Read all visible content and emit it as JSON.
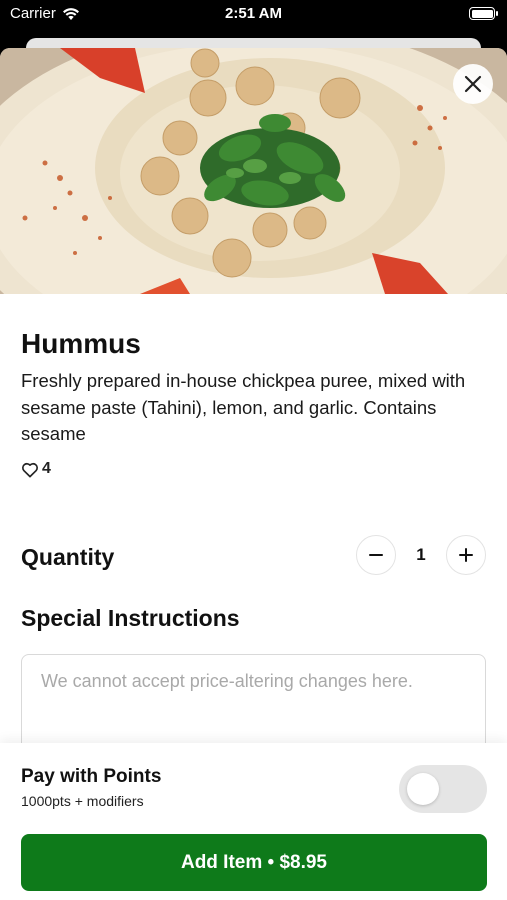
{
  "status_bar": {
    "carrier": "Carrier",
    "time": "2:51 AM"
  },
  "item": {
    "name": "Hummus",
    "description": "Freshly prepared in-house chickpea puree, mixed with sesame paste (Tahini), lemon, and garlic. Contains sesame",
    "likes": "4",
    "image_alt": "hummus-photo"
  },
  "quantity": {
    "label": "Quantity",
    "value": "1",
    "decrement": "−",
    "increment": "+"
  },
  "instructions": {
    "label": "Special Instructions",
    "placeholder": "We cannot accept price-altering changes here.",
    "value": ""
  },
  "points": {
    "title": "Pay with Points",
    "subtitle": "1000pts + modifiers",
    "enabled": false
  },
  "add_button": {
    "label": "Add Item • $8.95"
  },
  "colors": {
    "accent": "#0e7a1a",
    "toggle_off": "#e5e5e5"
  }
}
